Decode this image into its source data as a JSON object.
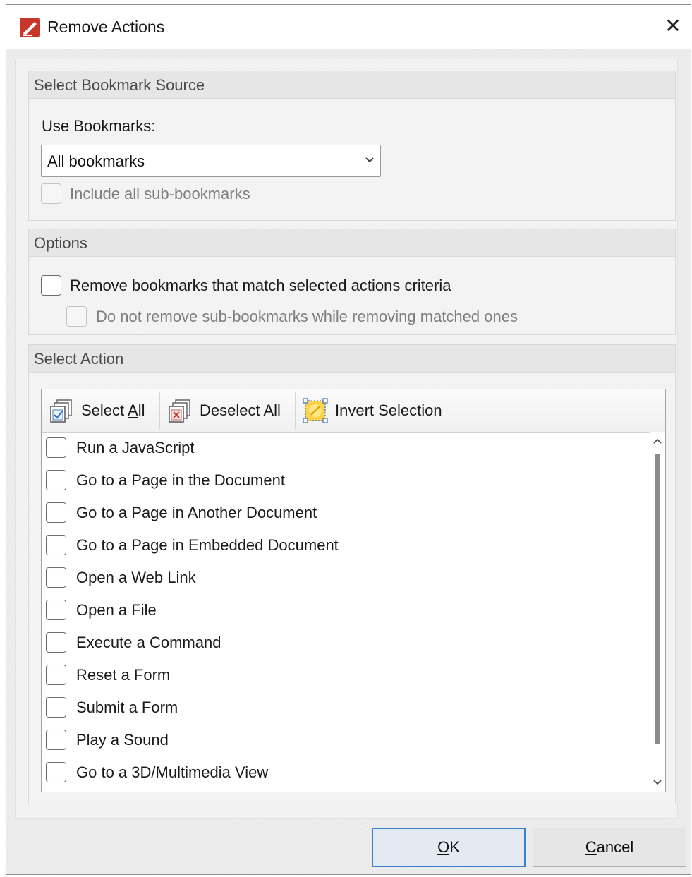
{
  "window": {
    "title": "Remove Actions",
    "close_glyph": "✕"
  },
  "bookmark_source": {
    "header": "Select Bookmark Source",
    "use_label": "Use Bookmarks:",
    "select_value": "All bookmarks",
    "include_sub": {
      "label": "Include all sub-bookmarks",
      "checked": false,
      "enabled": false
    }
  },
  "options": {
    "header": "Options",
    "remove_matching": {
      "label": "Remove bookmarks that match selected actions criteria",
      "checked": false,
      "enabled": true
    },
    "keep_sub": {
      "label": "Do not remove sub-bookmarks while removing matched ones",
      "checked": false,
      "enabled": false
    }
  },
  "select_action": {
    "header": "Select Action",
    "toolbar": {
      "select_all_pre": "Select ",
      "select_all_u": "A",
      "select_all_post": "ll",
      "deselect_all": "Deselect All",
      "invert": "Invert Selection"
    },
    "items": [
      {
        "label": "Run a JavaScript",
        "checked": false
      },
      {
        "label": "Go to a Page in the Document",
        "checked": false
      },
      {
        "label": "Go to a Page in Another Document",
        "checked": false
      },
      {
        "label": "Go to a Page in Embedded Document",
        "checked": false
      },
      {
        "label": "Open a Web Link",
        "checked": false
      },
      {
        "label": "Open a File",
        "checked": false
      },
      {
        "label": "Execute a Command",
        "checked": false
      },
      {
        "label": "Reset a Form",
        "checked": false
      },
      {
        "label": "Submit a Form",
        "checked": false
      },
      {
        "label": "Play a Sound",
        "checked": false
      },
      {
        "label": "Go to a 3D/Multimedia View",
        "checked": false
      }
    ]
  },
  "footer": {
    "ok_u": "O",
    "ok_rest": "K",
    "cancel_u": "C",
    "cancel_rest": "ancel"
  },
  "colors": {
    "accent": "#3c7fd1",
    "app_icon": "#c8352a"
  }
}
